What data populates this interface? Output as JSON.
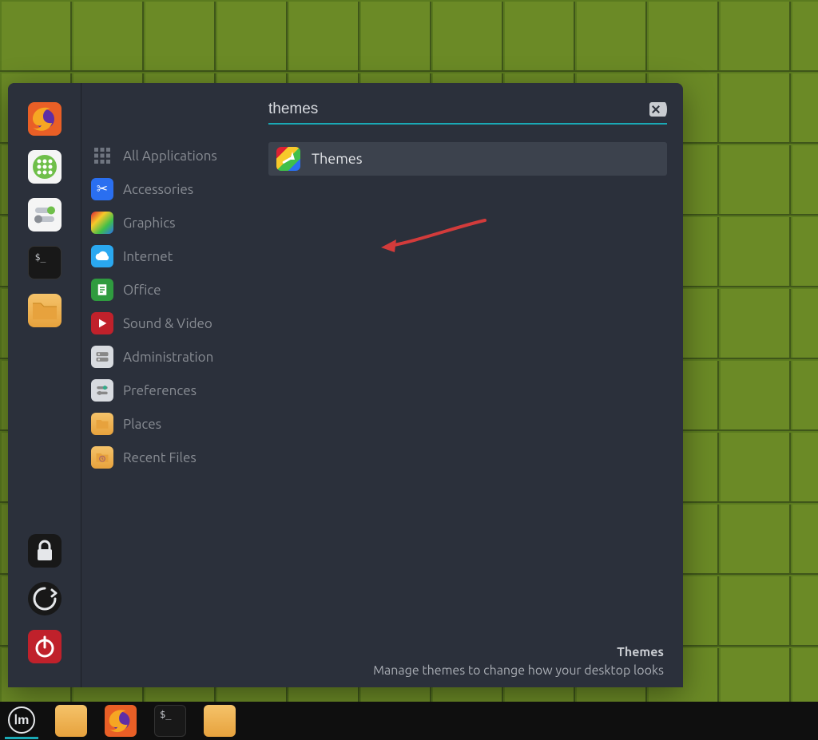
{
  "search": {
    "value": "themes"
  },
  "favorites": [
    {
      "id": "firefox",
      "name": "firefox-launcher"
    },
    {
      "id": "allapps",
      "name": "all-apps-launcher"
    },
    {
      "id": "settings",
      "name": "system-settings-launcher"
    },
    {
      "id": "terminal",
      "name": "terminal-launcher"
    },
    {
      "id": "files",
      "name": "files-launcher"
    }
  ],
  "session": [
    {
      "id": "lock",
      "name": "lock-screen-button"
    },
    {
      "id": "logout",
      "name": "logout-button"
    },
    {
      "id": "power",
      "name": "power-button"
    }
  ],
  "categories": [
    {
      "id": "all",
      "label": "All Applications"
    },
    {
      "id": "accessories",
      "label": "Accessories"
    },
    {
      "id": "graphics",
      "label": "Graphics"
    },
    {
      "id": "internet",
      "label": "Internet"
    },
    {
      "id": "office",
      "label": "Office"
    },
    {
      "id": "sound",
      "label": "Sound & Video"
    },
    {
      "id": "admin",
      "label": "Administration"
    },
    {
      "id": "prefs",
      "label": "Preferences"
    },
    {
      "id": "places",
      "label": "Places"
    },
    {
      "id": "recent",
      "label": "Recent Files"
    }
  ],
  "results": [
    {
      "label": "Themes"
    }
  ],
  "description": {
    "title": "Themes",
    "text": "Manage themes to change how your desktop looks"
  },
  "taskbar": [
    {
      "id": "mint",
      "name": "menu-button",
      "active": true
    },
    {
      "id": "files1",
      "name": "files-taskbar"
    },
    {
      "id": "firefox",
      "name": "firefox-taskbar"
    },
    {
      "id": "terminal",
      "name": "terminal-taskbar"
    },
    {
      "id": "files2",
      "name": "files-taskbar-2"
    }
  ]
}
